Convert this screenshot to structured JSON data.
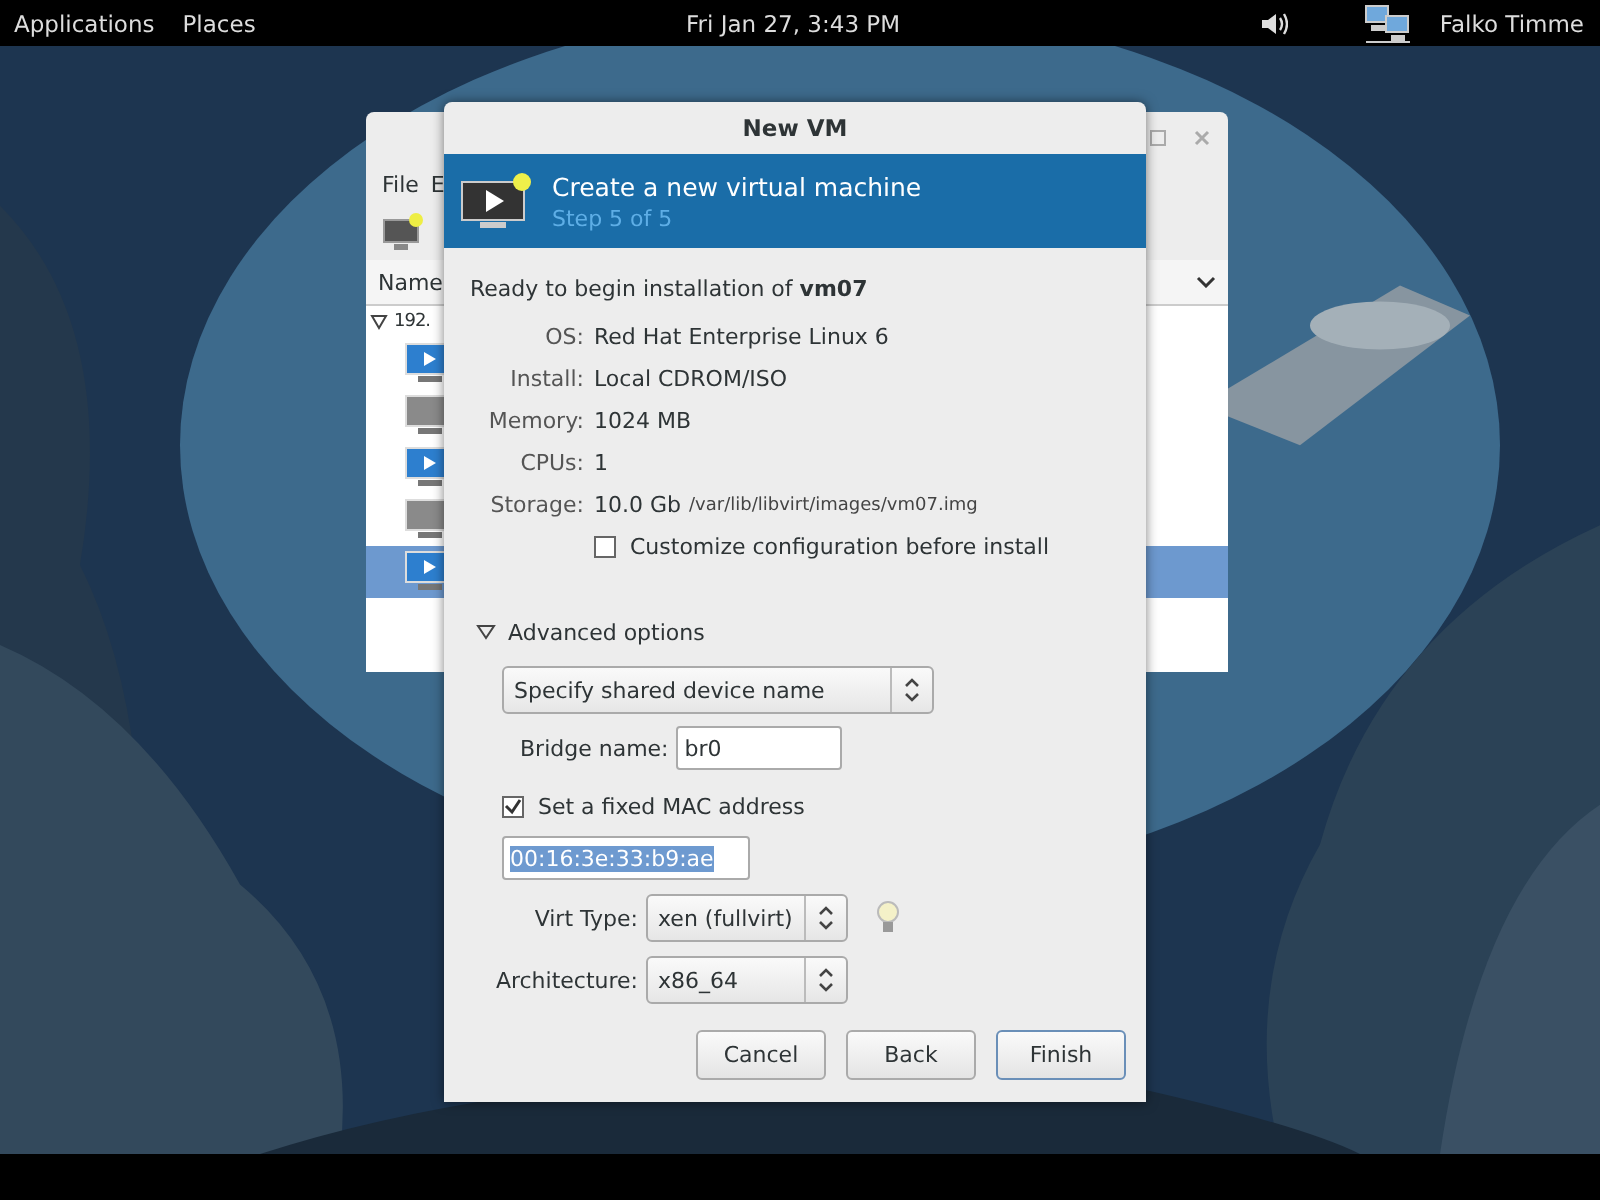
{
  "top_bar": {
    "menus": [
      "Applications",
      "Places"
    ],
    "clock": "Fri Jan 27,  3:43 PM",
    "user": "Falko Timme"
  },
  "background_window": {
    "menu": [
      "File",
      "E"
    ],
    "column_header": "Name",
    "tree": {
      "label": "192.",
      "expanded": true,
      "children": [
        {
          "running": true,
          "selected": false
        },
        {
          "running": false,
          "selected": false
        },
        {
          "running": true,
          "selected": false
        },
        {
          "running": false,
          "selected": false
        },
        {
          "running": true,
          "selected": true
        }
      ]
    }
  },
  "dialog": {
    "title": "New VM",
    "header": {
      "title": "Create a new virtual machine",
      "step": "Step 5 of 5"
    },
    "intro": "Ready to begin installation of **vm07**",
    "details": [
      {
        "label": "OS:",
        "value": "Red Hat Enterprise Linux 6"
      },
      {
        "label": "Install:",
        "value": "Local CDROM/ISO"
      },
      {
        "label": "Memory:",
        "value": "1024 MB"
      },
      {
        "label": "CPUs:",
        "value": "1"
      },
      {
        "label": "Storage:",
        "value": "10.0 Gb",
        "note": "/var/lib/libvirt/images/vm07.img"
      }
    ],
    "customize": {
      "label": "Customize configuration before install",
      "checked": false
    },
    "advanced": {
      "label": "Advanced options",
      "expanded": true
    },
    "network_source": {
      "value": "Specify shared device name"
    },
    "bridge": {
      "label": "Bridge name:",
      "value": "br0"
    },
    "fixed_mac": {
      "label": "Set a fixed MAC address",
      "checked": true
    },
    "mac": {
      "value": "00:16:3e:33:b9:ae",
      "selected": true
    },
    "virt_type": {
      "label": "Virt Type:",
      "value": "xen (fullvirt)"
    },
    "architecture": {
      "label": "Architecture:",
      "value": "x86_64"
    },
    "buttons": [
      {
        "label": "Cancel",
        "default": false
      },
      {
        "label": "Back",
        "default": false
      },
      {
        "label": "Finish",
        "default": true
      }
    ]
  }
}
